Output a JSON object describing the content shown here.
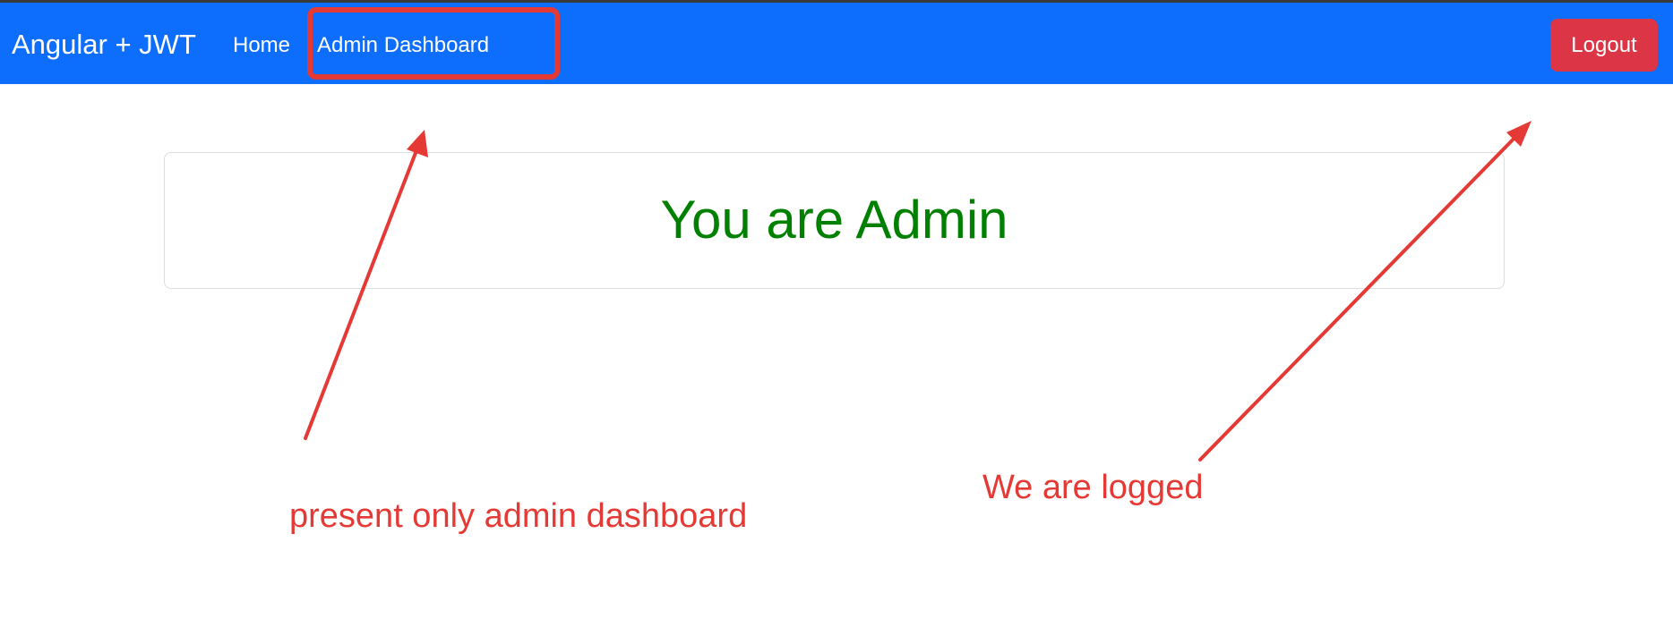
{
  "navbar": {
    "brand": "Angular + JWT",
    "links": [
      {
        "label": "Home"
      },
      {
        "label": "Admin Dashboard"
      }
    ],
    "logout_label": "Logout",
    "background_color": "#0d6efd",
    "logout_color": "#dc3545"
  },
  "main": {
    "card_title": "You are Admin",
    "title_color": "#008000"
  },
  "annotations": {
    "color": "#e53935",
    "labels": [
      {
        "text": "present only admin dashboard"
      },
      {
        "text": "We are logged"
      }
    ]
  }
}
